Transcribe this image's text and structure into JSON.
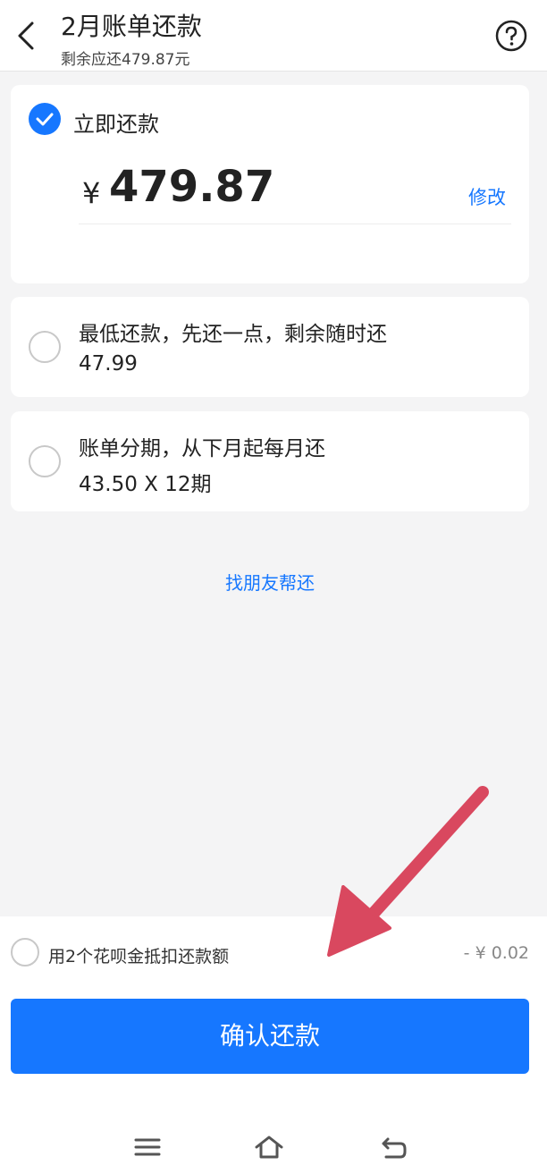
{
  "header": {
    "title": "2月账单还款",
    "subtitle": "剩余应还479.87元",
    "back_icon": "chevron-left-icon",
    "help_icon": "question-circle-icon"
  },
  "pay_now": {
    "label": "立即还款",
    "selected": true,
    "currency": "¥",
    "amount": "479.87",
    "modify_label": "修改"
  },
  "minimum": {
    "title": "最低还款，先还一点，剩余随时还",
    "value": "47.99",
    "selected": false
  },
  "installment": {
    "title": "账单分期，从下月起每月还",
    "value": "43.50 X 12期",
    "selected": false
  },
  "friend_link": "找朋友帮还",
  "deduction": {
    "label": "用2个花呗金抵扣还款额",
    "amount": "- ¥ 0.02",
    "selected": false
  },
  "confirm_label": "确认还款",
  "nav": {
    "menu_icon": "menu-icon",
    "home_icon": "home-icon",
    "back_icon": "back-icon"
  },
  "colors": {
    "accent": "#1677ff",
    "annotation_arrow": "#d9485f",
    "background": "#f4f4f5"
  }
}
